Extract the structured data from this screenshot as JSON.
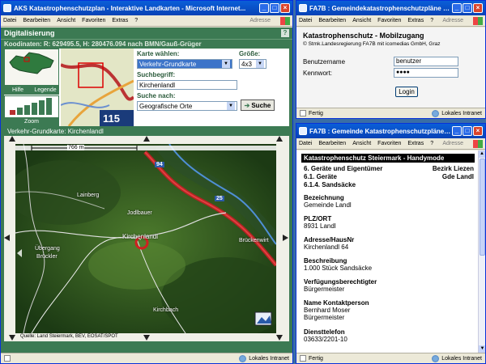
{
  "ie_menu": [
    "Datei",
    "Bearbeiten",
    "Ansicht",
    "Favoriten",
    "Extras",
    "?"
  ],
  "address_label": "Adresse",
  "left_window": {
    "title": "AKS Katastrophenschutzplan - Interaktive Landkarten - Microsoft Internet...",
    "header": "Digitalisierung",
    "help": "?",
    "coords": "Koodinaten: R: 629495.5, H: 280476.094 nach BMN/Gauß-Grüger",
    "left_buttons": {
      "hilfe": "Hilfe",
      "legende": "Legende",
      "zoom": "Zoom"
    },
    "minimap_text": "115",
    "karte_label": "Karte wählen:",
    "karte_value": "Verkehr-Grundkarte",
    "groesse_label": "Größe:",
    "groesse_value": "4x3",
    "suchbegriff_label": "Suchbegriff:",
    "suchbegriff_value": "Kirchenlandl",
    "suche_nach_label": "Suche nach:",
    "suche_nach_value": "Geografische Orte",
    "suche_button": "Suche",
    "map_caption": "Verkehr-Grundkarte: Kirchenlandl",
    "scale": "766 m",
    "road_badge_1": "94",
    "road_badge_2": "25",
    "map_labels": [
      "Lainberg",
      "Jodlbauer",
      "Kirchenlandl",
      "Übergang",
      "Brückler",
      "Brückenwirt",
      "Kirchbach"
    ],
    "source": "Quelle: Land Steiermark, BEV, EOSAT/SPOT",
    "status_zone": "Lokales Intranet"
  },
  "login_window": {
    "title": "FA7B : Gemeindekatastrophenschutzpläne - Micr...",
    "heading": "Katastrophenschutz - Mobilzugang",
    "copyright": "© Stmk.Landesregierung FA7B mit icomedias GmbH, Graz",
    "username_label": "Benutzername",
    "username_value": "benutzer",
    "password_label": "Kennwort:",
    "password_value": "●●●●",
    "login_button": "Login",
    "status_left": "Fertig",
    "status_zone": "Lokales Intranet"
  },
  "detail_window": {
    "title": "FA7B : Gemeinde Katastrophenschutzpläne - Mic...",
    "banner": "Katastrophenschutz Steiermark - Handymode",
    "line1_left": "6. Geräte und Eigentümer",
    "line1_right": "Bezirk Liezen",
    "line2_left": "6.1. Geräte",
    "line2_right": "Gde Landl",
    "line3": "6.1.4. Sandsäcke",
    "fields": [
      {
        "label": "Bezeichnung",
        "values": [
          "Gemeinde Landl"
        ]
      },
      {
        "label": "PLZ/ORT",
        "values": [
          "8931 Landl"
        ]
      },
      {
        "label": "Adresse/HausNr",
        "values": [
          "Kirchenlandl 64"
        ]
      },
      {
        "label": "Beschreibung",
        "values": [
          "1.000 Stück Sandsäcke"
        ]
      },
      {
        "label": "Verfügungsberechtigter",
        "values": [
          "Bürgermeister"
        ]
      },
      {
        "label": "Name Kontaktperson",
        "values": [
          "Bernhard Moser",
          "Bürgermeister"
        ]
      },
      {
        "label": "Diensttelefon",
        "values": [
          "03633/2201-10"
        ]
      }
    ],
    "status_left": "Fertig",
    "status_zone": "Lokales Intranet"
  }
}
